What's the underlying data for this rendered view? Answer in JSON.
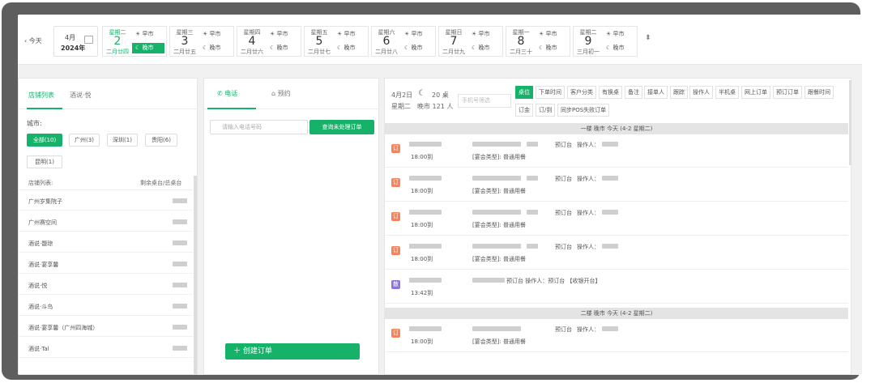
{
  "header": {
    "today": "‹ 今天",
    "month": "4月",
    "year": "2024年",
    "updown": "⬍",
    "days": [
      {
        "week": "星期二",
        "num": "2",
        "lunar": "二月廿四",
        "s1": "☀ 早市",
        "s2": "☾ 晚市",
        "active": true
      },
      {
        "week": "星期三",
        "num": "3",
        "lunar": "二月廿五",
        "s1": "☀ 早市",
        "s2": "☾ 晚市"
      },
      {
        "week": "星期四",
        "num": "4",
        "lunar": "二月廿六",
        "s1": "☀ 早市",
        "s2": "☾ 晚市"
      },
      {
        "week": "星期五",
        "num": "5",
        "lunar": "二月廿七",
        "s1": "☀ 早市",
        "s2": "☾ 晚市"
      },
      {
        "week": "星期六",
        "num": "6",
        "lunar": "二月廿八",
        "s1": "☀ 早市",
        "s2": "☾ 晚市"
      },
      {
        "week": "星期日",
        "num": "7",
        "lunar": "二月廿九",
        "s1": "☀ 早市",
        "s2": "☾ 晚市"
      },
      {
        "week": "星期一",
        "num": "8",
        "lunar": "二月三十",
        "s1": "☀ 早市",
        "s2": "☾ 晚市"
      },
      {
        "week": "星期二",
        "num": "9",
        "lunar": "三月初一",
        "s1": "☀ 早市",
        "s2": "☾ 晚市"
      }
    ]
  },
  "stores": {
    "tab_list": "店铺列表",
    "tab_other": "酒说·悦",
    "city_label": "城市:",
    "chips": [
      "全部(10)",
      "广州(3)",
      "深圳(1)",
      "贵阳(6)",
      "昆明(1)"
    ],
    "col_name": "店铺列表:",
    "col_tables": "剩余桌台/总桌台",
    "rows": [
      "广州岁集院子",
      "广州赛空间",
      "酒说·馥琼",
      "酒说·宴享馨",
      "酒说·悦",
      "酒说·斗鸟",
      "酒说·宴享馨（广州四海城）",
      "酒说·Tal"
    ]
  },
  "middle": {
    "tab_phone": "电话",
    "tab_reserve": "预约",
    "phone_placeholder": "请输入电话号码",
    "query_btn": "查询未处理订单",
    "create_btn": "＋ 创建订单"
  },
  "orders": {
    "date": "4月2日",
    "weekday": "星期二",
    "moon": "☾",
    "table_count": "20 桌",
    "evening_count": "晚市 121 人",
    "mobile_placeholder": "手机号筛选",
    "filters_row1": [
      "桌位",
      "下单时间",
      "客户分类",
      "有换桌",
      "备注",
      "接单人",
      "跟踪",
      "操作人",
      "半机桌",
      "网上订单",
      "预订订单",
      "跟餐时间"
    ],
    "filters_row2": [
      "订金",
      "订/到",
      "同步POS失败订单"
    ],
    "section1": "一楼   晚市        今天 (4-2 星期二)",
    "section2": "二楼   晚市        今天 (4-2 星期二)",
    "items": [
      {
        "icon": "订",
        "time": "18:00到",
        "type": "[宴会类型]: 普通用餐",
        "pre": "预订台",
        "op": "操作人："
      },
      {
        "icon": "订",
        "time": "18:00到",
        "type": "[宴会类型]: 普通用餐",
        "pre": "预订台",
        "op": "操作人："
      },
      {
        "icon": "订",
        "time": "18:00到",
        "type": "[宴会类型]: 普通用餐",
        "pre": "预订台",
        "op": "操作人："
      },
      {
        "icon": "订",
        "time": "18:00到",
        "type": "[宴会类型]: 普通用餐",
        "pre": "预订台",
        "op": "操作人："
      },
      {
        "icon": "散",
        "time": "13:42到",
        "type": "预订台  操作人：预订台  【收银开台】",
        "pre": "",
        "op": ""
      },
      {
        "icon": "订",
        "time": "18:00到",
        "type": "[宴会类型]: 普通用餐",
        "pre": "预订台",
        "op": "操作人："
      }
    ]
  }
}
